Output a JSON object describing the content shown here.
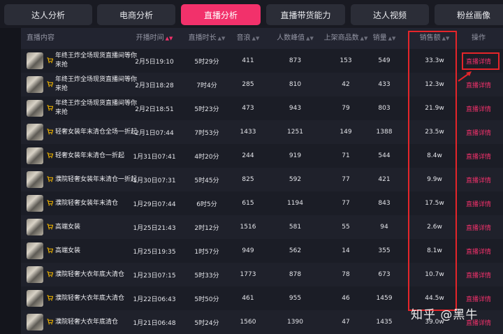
{
  "tabs": [
    {
      "label": "达人分析",
      "active": false
    },
    {
      "label": "电商分析",
      "active": false
    },
    {
      "label": "直播分析",
      "active": true
    },
    {
      "label": "直播带货能力",
      "active": false
    },
    {
      "label": "达人视频",
      "active": false
    },
    {
      "label": "粉丝画像",
      "active": false
    }
  ],
  "table": {
    "headers": {
      "content": "直播内容",
      "start_time": "开播时间",
      "duration": "直播时长",
      "sound_waves": "音浪",
      "peak_viewers": "人数峰值",
      "products": "上架商品数",
      "sales_count": "销量",
      "sales_amount": "销售额",
      "action": "操作"
    },
    "rows": [
      {
        "title": "年终王炸全场现货直播间等你来抢",
        "start_time": "2月5日19:10",
        "duration": "5时29分",
        "sound_waves": "411",
        "peak_viewers": "873",
        "products": "153",
        "sales_count": "549",
        "sales_amount": "33.3w",
        "action": "直播详情"
      },
      {
        "title": "年终王炸全场现货直播间等你来抢",
        "start_time": "2月3日18:28",
        "duration": "7时4分",
        "sound_waves": "285",
        "peak_viewers": "810",
        "products": "42",
        "sales_count": "433",
        "sales_amount": "12.3w",
        "action": "直播详情"
      },
      {
        "title": "年终王炸全场现货直播间等你来抢",
        "start_time": "2月2日18:51",
        "duration": "5时23分",
        "sound_waves": "473",
        "peak_viewers": "943",
        "products": "79",
        "sales_count": "803",
        "sales_amount": "21.9w",
        "action": "直播详情"
      },
      {
        "title": "轻奢女装年末清仓全场一折起",
        "start_time": "2月1日07:44",
        "duration": "7时53分",
        "sound_waves": "1433",
        "peak_viewers": "1251",
        "products": "149",
        "sales_count": "1388",
        "sales_amount": "23.5w",
        "action": "直播详情"
      },
      {
        "title": "轻奢女装年末清仓一折起",
        "start_time": "1月31日07:41",
        "duration": "4时20分",
        "sound_waves": "244",
        "peak_viewers": "919",
        "products": "71",
        "sales_count": "544",
        "sales_amount": "8.4w",
        "action": "直播详情"
      },
      {
        "title": "濮院轻奢女装年末清仓一折起",
        "start_time": "1月30日07:31",
        "duration": "5时45分",
        "sound_waves": "825",
        "peak_viewers": "592",
        "products": "77",
        "sales_count": "421",
        "sales_amount": "9.9w",
        "action": "直播详情"
      },
      {
        "title": "濮院轻奢女装年末清仓",
        "start_time": "1月29日07:44",
        "duration": "6时5分",
        "sound_waves": "615",
        "peak_viewers": "1194",
        "products": "77",
        "sales_count": "843",
        "sales_amount": "17.5w",
        "action": "直播详情"
      },
      {
        "title": "高端女装",
        "start_time": "1月25日21:43",
        "duration": "2时12分",
        "sound_waves": "1516",
        "peak_viewers": "581",
        "products": "55",
        "sales_count": "94",
        "sales_amount": "2.6w",
        "action": "直播详情"
      },
      {
        "title": "高端女装",
        "start_time": "1月25日19:35",
        "duration": "1时57分",
        "sound_waves": "949",
        "peak_viewers": "562",
        "products": "14",
        "sales_count": "355",
        "sales_amount": "8.1w",
        "action": "直播详情"
      },
      {
        "title": "濮院轻奢大衣年底大清仓",
        "start_time": "1月23日07:15",
        "duration": "5时33分",
        "sound_waves": "1773",
        "peak_viewers": "878",
        "products": "78",
        "sales_count": "673",
        "sales_amount": "10.7w",
        "action": "直播详情"
      },
      {
        "title": "濮院轻奢大衣年底大清仓",
        "start_time": "1月22日06:43",
        "duration": "5时50分",
        "sound_waves": "461",
        "peak_viewers": "955",
        "products": "46",
        "sales_count": "1459",
        "sales_amount": "44.5w",
        "action": "直播详情"
      },
      {
        "title": "濮院轻奢大衣年底清仓",
        "start_time": "1月21日06:48",
        "duration": "5时24分",
        "sound_waves": "1560",
        "peak_viewers": "1390",
        "products": "47",
        "sales_count": "1435",
        "sales_amount": "39.0w",
        "action": "直播详情"
      }
    ]
  },
  "watermark": "知乎 @黑牛",
  "colors": {
    "accent": "#f2316b",
    "highlight_box": "#e5252a",
    "cart_icon": "#f5b800"
  }
}
